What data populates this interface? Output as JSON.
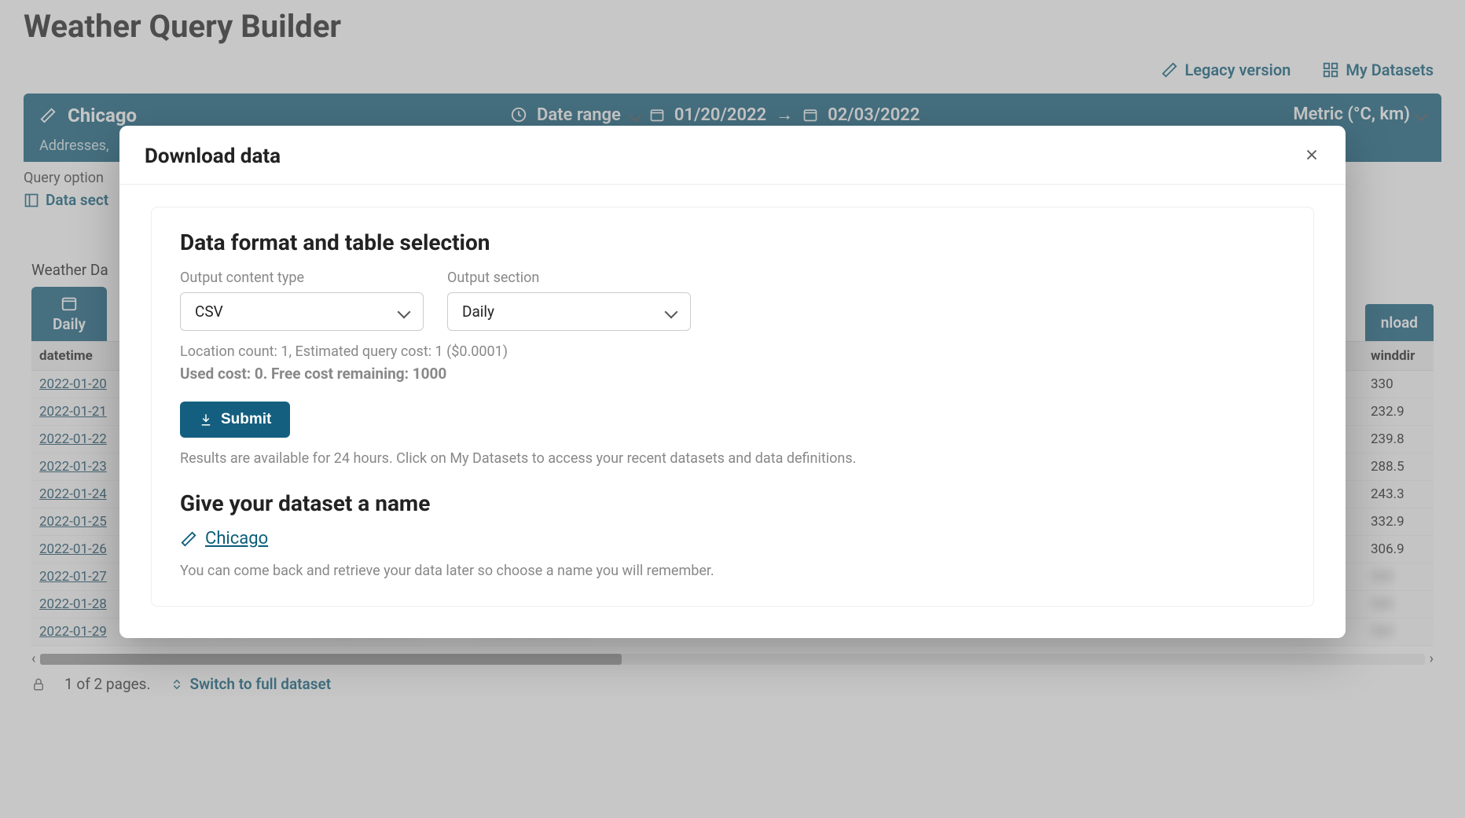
{
  "page": {
    "title": "Weather Query Builder",
    "legacy_link": "Legacy version",
    "my_datasets": "My Datasets"
  },
  "query_bar": {
    "location": "Chicago",
    "addresses_hint": "Addresses,",
    "date_range_label": "Date range",
    "date_start": "01/20/2022",
    "date_end": "02/03/2022",
    "units": "Metric (°C, km)"
  },
  "query_options_label": "Query option",
  "data_sections_link": "Data sect",
  "weather_preview_label": "Weather Da",
  "tabs": {
    "daily": "Daily"
  },
  "download_btn": "nload",
  "table": {
    "col_datetime": "datetime",
    "col_winddir": "winddir",
    "rows": [
      {
        "date": "2022-01-20",
        "winddir": "330"
      },
      {
        "date": "2022-01-21",
        "winddir": "232.9"
      },
      {
        "date": "2022-01-22",
        "winddir": "239.8"
      },
      {
        "date": "2022-01-23",
        "winddir": "288.5"
      },
      {
        "date": "2022-01-24",
        "winddir": "243.3"
      },
      {
        "date": "2022-01-25",
        "winddir": "332.9"
      },
      {
        "date": "2022-01-26",
        "winddir": "306.9"
      },
      {
        "date": "2022-01-27",
        "winddir": ""
      },
      {
        "date": "2022-01-28",
        "winddir": ""
      },
      {
        "date": "2022-01-29",
        "winddir": ""
      }
    ]
  },
  "pager": {
    "text": "1 of 2 pages.",
    "switch": "Switch to full dataset"
  },
  "modal": {
    "title": "Download data",
    "section_title": "Data format and table selection",
    "out_type_label": "Output content type",
    "out_type_value": "CSV",
    "out_section_label": "Output section",
    "out_section_value": "Daily",
    "cost_line": "Location count: 1, Estimated query cost: 1 ($0.0001)",
    "cost_line2": "Used cost: 0. Free cost remaining: 1000",
    "submit": "Submit",
    "availability": "Results are available for 24 hours. Click on My Datasets to access your recent datasets and data definitions.",
    "name_header": "Give your dataset a name",
    "dataset_name": "Chicago",
    "name_hint": "You can come back and retrieve your data later so choose a name you will remember."
  }
}
